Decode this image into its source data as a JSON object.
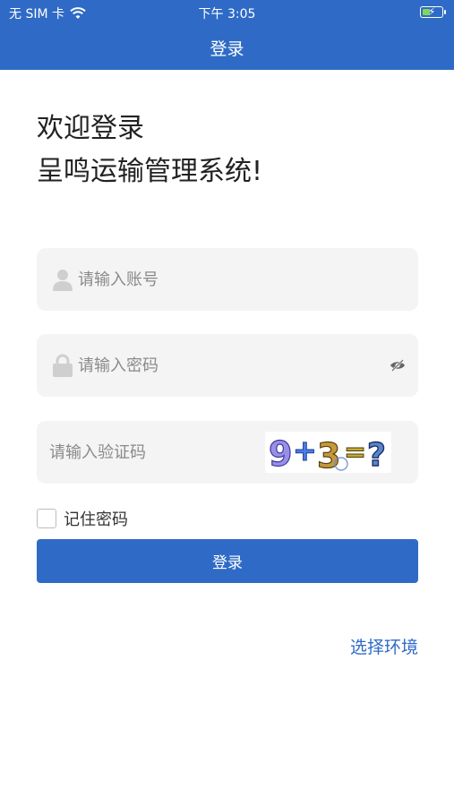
{
  "status_bar": {
    "carrier": "无 SIM 卡",
    "time": "下午 3:05"
  },
  "nav": {
    "title": "登录"
  },
  "welcome": {
    "line1": "欢迎登录",
    "line2": "呈鸣运输管理系统!"
  },
  "form": {
    "account_placeholder": "请输入账号",
    "password_placeholder": "请输入密码",
    "captcha_placeholder": "请输入验证码",
    "captcha_text": "9+3=?",
    "remember_label": "记住密码",
    "remember_checked": false,
    "login_button": "登录"
  },
  "footer": {
    "env_link": "选择环境"
  },
  "colors": {
    "primary": "#2f6bc6",
    "field_bg": "#f4f4f4"
  },
  "icons": {
    "account": "user-icon",
    "password": "lock-icon",
    "toggle_visibility": "eye-off-icon",
    "wifi": "wifi-icon",
    "battery": "battery-charging-icon"
  }
}
